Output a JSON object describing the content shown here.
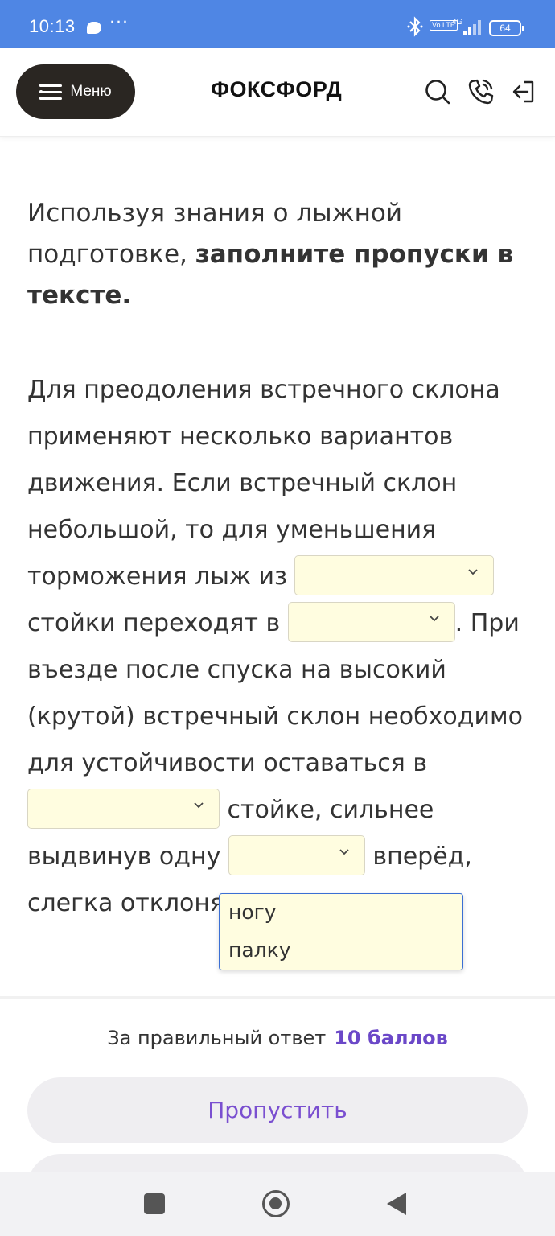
{
  "status_bar": {
    "time": "10:13",
    "dots": "···",
    "volte": "Vo LTE",
    "network": "4G",
    "battery": "64"
  },
  "header": {
    "menu_label": "Меню",
    "logo": "ФОКСФОРД",
    "icons": [
      "search-icon",
      "phone-icon",
      "logout-icon"
    ]
  },
  "question": {
    "intro_plain": "Используя знания о лыжной подготовке, ",
    "intro_bold": "заполните пропуски в тексте.",
    "text_1": "Для преодоления встречного склона применяют несколько вариантов движения. Если встречный склон небольшой, то для уменьшения торможения лыж из ",
    "text_2": " стойки переходят в ",
    "text_3": ". При въезде после спуска на высокий (крутой) встречный склон необходимо для устойчивости оставаться в ",
    "text_4": " стойке, сильнее выдвинув одну ",
    "text_5": " вперёд, слегка отклоняя",
    "blanks": [
      "",
      "",
      "",
      ""
    ]
  },
  "dropdown": {
    "options": [
      "ногу",
      "палку"
    ]
  },
  "footer": {
    "reward_text": "За правильный ответ",
    "reward_points": "10 баллов",
    "skip_label": "Пропустить"
  },
  "colors": {
    "status_bar": "#4f86e4",
    "accent": "#7a4fd0",
    "blank_bg": "#fffde0",
    "dropdown_border": "#3b6fd4"
  }
}
